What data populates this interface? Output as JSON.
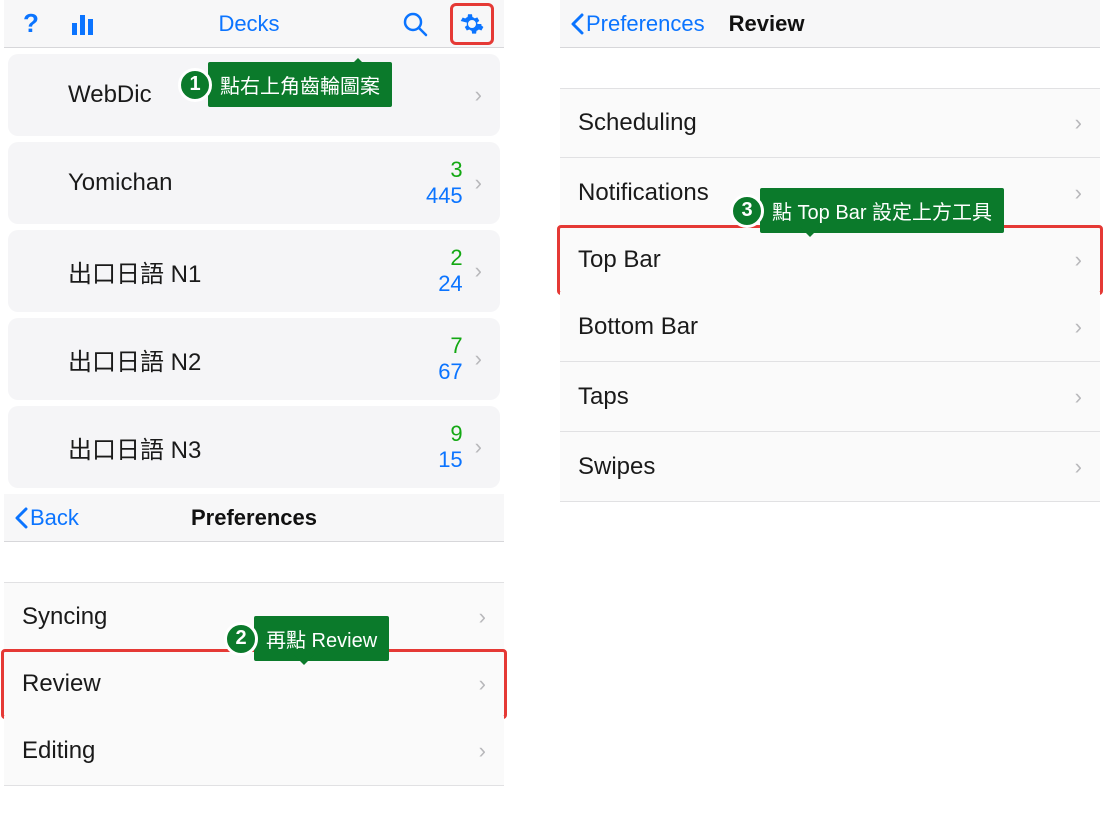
{
  "decks": {
    "title": "Decks",
    "items": [
      {
        "name": "WebDic",
        "new": "",
        "due": ""
      },
      {
        "name": "Yomichan",
        "new": "3",
        "due": "445"
      },
      {
        "name": "出口日語 N1",
        "new": "2",
        "due": "24"
      },
      {
        "name": "出口日語 N2",
        "new": "7",
        "due": "67"
      },
      {
        "name": "出口日語 N3",
        "new": "9",
        "due": "15"
      }
    ]
  },
  "prefs1": {
    "back": "Back",
    "title": "Preferences",
    "items": [
      {
        "label": "Syncing"
      },
      {
        "label": "Review"
      },
      {
        "label": "Editing"
      }
    ]
  },
  "prefs2": {
    "back": "Preferences",
    "title": "Review",
    "items": [
      {
        "label": "Scheduling"
      },
      {
        "label": "Notifications"
      },
      {
        "label": "Top Bar"
      },
      {
        "label": "Bottom Bar"
      },
      {
        "label": "Taps"
      },
      {
        "label": "Swipes"
      }
    ]
  },
  "callouts": {
    "c1": {
      "num": "1",
      "text": "點右上角齒輪圖案"
    },
    "c2": {
      "num": "2",
      "text": "再點 Review"
    },
    "c3": {
      "num": "3",
      "text": "點 Top Bar 設定上方工具"
    }
  }
}
